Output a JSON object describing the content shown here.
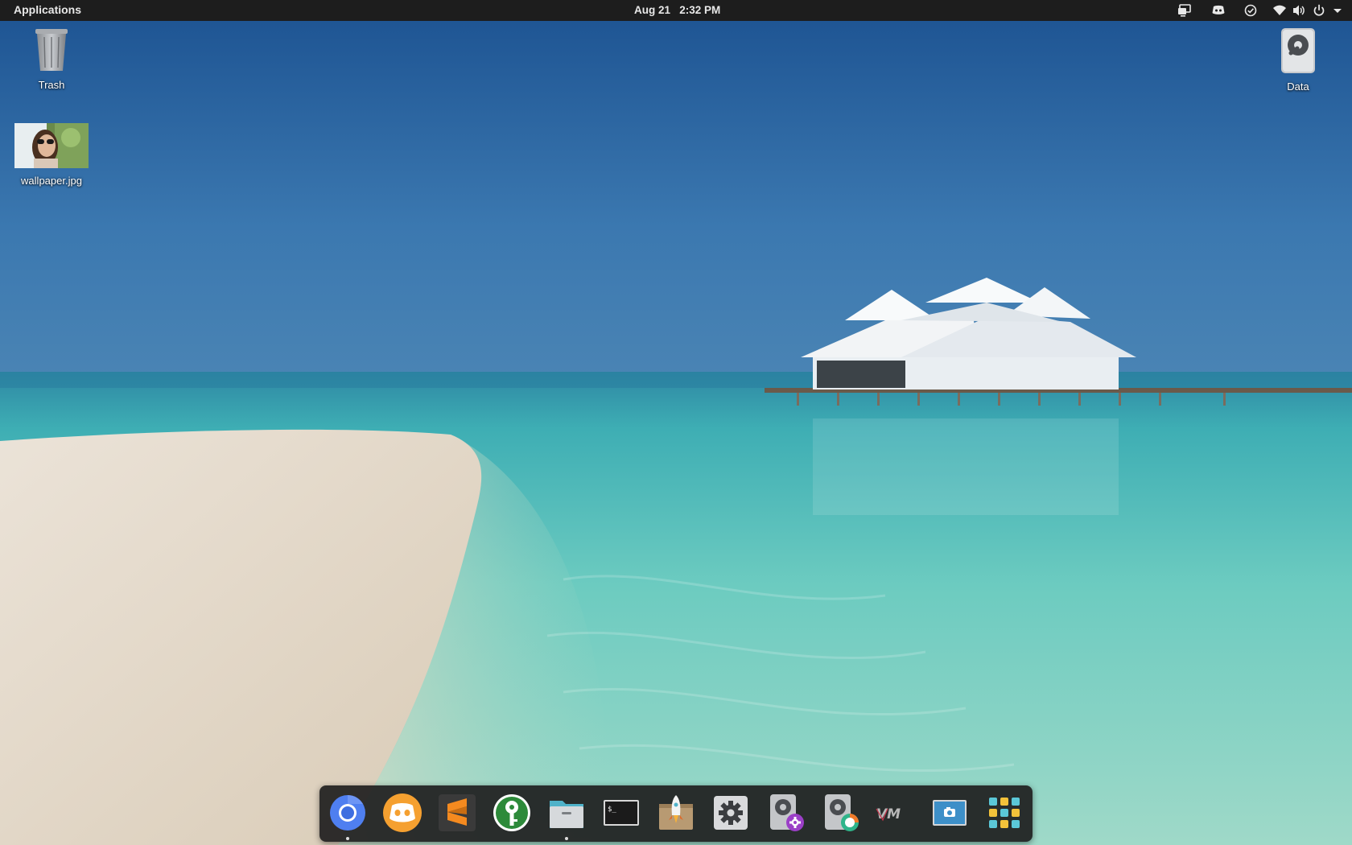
{
  "panel": {
    "applications_label": "Applications",
    "date": "Aug 21",
    "time": "2:32 PM",
    "tray_icons": [
      "display-icon",
      "discord-tray-icon",
      "check-circle-icon",
      "wifi-icon",
      "volume-icon",
      "power-icon",
      "chevron-down-icon"
    ]
  },
  "desktop": {
    "icons": [
      {
        "label": "Trash",
        "icon": "trash-icon"
      },
      {
        "label": "wallpaper.jpg",
        "icon": "image-thumbnail"
      },
      {
        "label": "Data",
        "icon": "drive-icon"
      }
    ]
  },
  "dock": {
    "items": [
      {
        "name": "chromium",
        "running": true
      },
      {
        "name": "discord",
        "running": false
      },
      {
        "name": "sublime-text",
        "running": false
      },
      {
        "name": "keepassxc",
        "running": false
      },
      {
        "name": "files",
        "running": true
      },
      {
        "name": "terminal",
        "running": false
      },
      {
        "name": "pop-shop",
        "running": false
      },
      {
        "name": "settings",
        "running": false
      },
      {
        "name": "disks",
        "running": false
      },
      {
        "name": "disk-usage",
        "running": false
      },
      {
        "name": "vmware",
        "running": false
      },
      {
        "name": "screenshot",
        "running": false
      },
      {
        "name": "app-grid",
        "running": false
      }
    ],
    "brand_colors": {
      "chromium": "#4f7ff0",
      "discord": "#f5a030",
      "sublime": "#f58a1f",
      "keepass": "#2d8a3a"
    }
  },
  "colors": {
    "panel_bg": "#1d1d1d",
    "sky_top": "#1f5694",
    "sea": "#4fc0b8",
    "sand": "#e6dcd0"
  }
}
